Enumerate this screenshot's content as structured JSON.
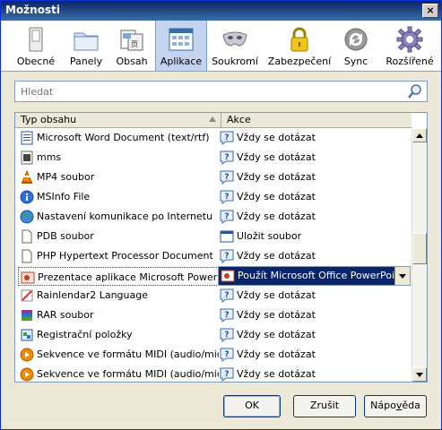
{
  "window": {
    "title": "Možnosti",
    "close_label": "×"
  },
  "toolbar": {
    "items": [
      {
        "label": "Obecné",
        "icon": "switch-icon"
      },
      {
        "label": "Panely",
        "icon": "folder-tabs-icon"
      },
      {
        "label": "Obsah",
        "icon": "document-icon"
      },
      {
        "label": "Aplikace",
        "icon": "applications-icon",
        "selected": true
      },
      {
        "label": "Soukromí",
        "icon": "mask-icon"
      },
      {
        "label": "Zabezpečení",
        "icon": "padlock-icon"
      },
      {
        "label": "Sync",
        "icon": "sync-icon"
      },
      {
        "label": "Rozšířené",
        "icon": "gear-icon"
      }
    ]
  },
  "search": {
    "placeholder": "Hledat"
  },
  "table": {
    "columns": [
      "Typ obsahu",
      "Akce"
    ],
    "rows": [
      {
        "type": "Microsoft Word Document (text/rtf)",
        "action": "Vždy se dotázat"
      },
      {
        "type": "mms",
        "action": "Vždy se dotázat"
      },
      {
        "type": "MP4 soubor",
        "action": "Vždy se dotázat"
      },
      {
        "type": "MSInfo File",
        "action": "Vždy se dotázat"
      },
      {
        "type": "Nastavení komunikace po Internetu",
        "action": "Vždy se dotázat"
      },
      {
        "type": "PDB soubor",
        "action": "Uložit soubor"
      },
      {
        "type": "PHP Hypertext Processor Document",
        "action": "Vždy se dotázat"
      },
      {
        "type": "Prezentace aplikace Microsoft PowerP...",
        "action": "Použít Microsoft Office PowerPoint...",
        "selected": true
      },
      {
        "type": "Rainlendar2 Language",
        "action": "Vždy se dotázat"
      },
      {
        "type": "RAR soubor",
        "action": "Vždy se dotázat"
      },
      {
        "type": "Registrační položky",
        "action": "Vždy se dotázat"
      },
      {
        "type": "Sekvence ve formátu MIDI (audio/mid)",
        "action": "Vždy se dotázat"
      },
      {
        "type": "Sekvence ve formátu MIDI (audio/midi)",
        "action": "Vždy se dotázat"
      }
    ]
  },
  "buttons": {
    "ok": "OK",
    "cancel": "Zrušit",
    "help_pre": "Nápo",
    "help_u": "v",
    "help_post": "ěda"
  },
  "colors": {
    "title_bar": "#0a246a",
    "selection": "#0a246a",
    "dialog_bg": "#ece9d8"
  }
}
